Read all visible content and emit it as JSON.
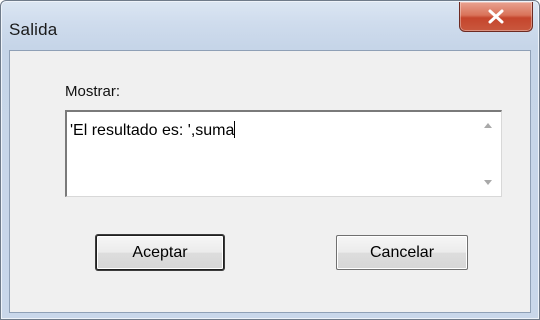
{
  "window": {
    "title": "Salida",
    "close_icon": "close-x-icon"
  },
  "form": {
    "label": "Mostrar:",
    "value": "'El resultado es: ',suma",
    "scroll_up_icon": "scroll-up-arrow-icon",
    "scroll_down_icon": "scroll-down-arrow-icon"
  },
  "buttons": {
    "ok_label": "Aceptar",
    "cancel_label": "Cancelar"
  },
  "colors": {
    "close_button": "#c9583e",
    "title_bar": "#cfdced",
    "client_background": "#f0f0f0"
  }
}
